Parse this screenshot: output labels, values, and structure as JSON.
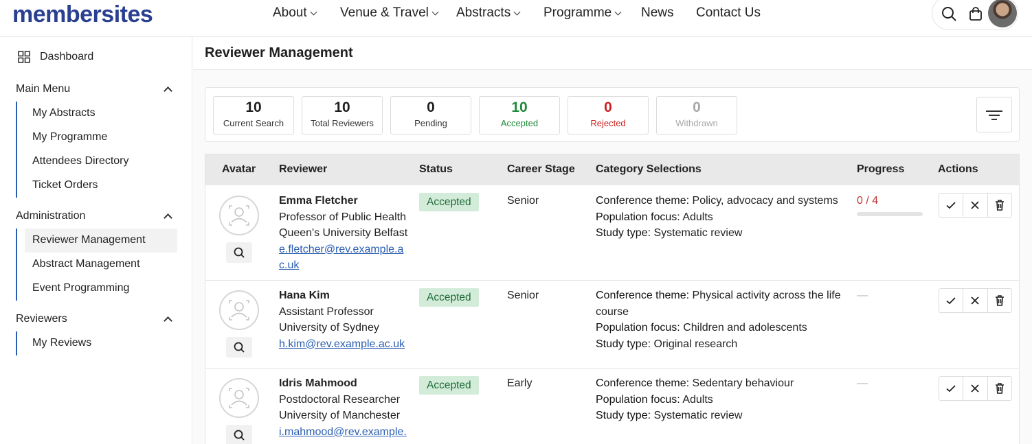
{
  "brand": {
    "logo_text": "membersites",
    "color": "#2a3f8f"
  },
  "nav": {
    "items": [
      {
        "label": "About",
        "has_dropdown": true
      },
      {
        "label": "Venue & Travel",
        "has_dropdown": true
      },
      {
        "label": "Abstracts",
        "has_dropdown": true
      },
      {
        "label": "Programme",
        "has_dropdown": true
      },
      {
        "label": "News",
        "has_dropdown": false
      },
      {
        "label": "Contact Us",
        "has_dropdown": false
      }
    ],
    "icons": [
      "search-icon",
      "cart-icon",
      "user-avatar"
    ]
  },
  "sidebar": {
    "dashboard_label": "Dashboard",
    "sections": [
      {
        "title": "Main Menu",
        "items": [
          "My Abstracts",
          "My Programme",
          "Attendees Directory",
          "Ticket Orders"
        ]
      },
      {
        "title": "Administration",
        "items": [
          "Reviewer Management",
          "Abstract Management",
          "Event Programming"
        ],
        "active": "Reviewer Management"
      },
      {
        "title": "Reviewers",
        "items": [
          "My Reviews"
        ]
      }
    ]
  },
  "page": {
    "title": "Reviewer Management"
  },
  "stats": [
    {
      "value": "10",
      "label": "Current Search",
      "tone": "default"
    },
    {
      "value": "10",
      "label": "Total Reviewers",
      "tone": "default"
    },
    {
      "value": "0",
      "label": "Pending",
      "tone": "default"
    },
    {
      "value": "10",
      "label": "Accepted",
      "tone": "green"
    },
    {
      "value": "0",
      "label": "Rejected",
      "tone": "red"
    },
    {
      "value": "0",
      "label": "Withdrawn",
      "tone": "grey"
    }
  ],
  "table": {
    "columns": [
      "Avatar",
      "Reviewer",
      "Status",
      "Career Stage",
      "Category Selections",
      "Progress",
      "Actions"
    ],
    "rows": [
      {
        "name": "Emma Fletcher",
        "title": "Professor of Public Health",
        "institution": "Queen's University Belfast",
        "email_line1": "e.fletcher@rev.example.a",
        "email_line2": "c.uk",
        "status": "Accepted",
        "career_stage": "Senior",
        "theme_key": "Conference theme:",
        "theme_val": "Policy, advocacy and systems",
        "theme_val2": "",
        "pop_key": "Population focus:",
        "pop_val": "Adults",
        "study_key": "Study type:",
        "study_val": "Systematic review",
        "progress": "0 / 4"
      },
      {
        "name": "Hana Kim",
        "title": "Assistant Professor",
        "institution": "University of Sydney",
        "email_line1": "h.kim@rev.example.ac.uk",
        "email_line2": "",
        "status": "Accepted",
        "career_stage": "Senior",
        "theme_key": "Conference theme:",
        "theme_val": "Physical activity across the life",
        "theme_val2": "course",
        "pop_key": "Population focus:",
        "pop_val": "Children and adolescents",
        "study_key": "Study type:",
        "study_val": "Original research",
        "progress": "—"
      },
      {
        "name": "Idris Mahmood",
        "title": "Postdoctoral Researcher",
        "institution": "University of Manchester",
        "email_line1": "i.mahmood@rev.example.",
        "email_line2": "",
        "status": "Accepted",
        "career_stage": "Early",
        "theme_key": "Conference theme:",
        "theme_val": "Sedentary behaviour",
        "theme_val2": "",
        "pop_key": "Population focus:",
        "pop_val": "Adults",
        "study_key": "Study type:",
        "study_val": "Systematic review",
        "progress": "—"
      }
    ]
  },
  "colors": {
    "accent": "#2a5db0",
    "accepted_bg": "#d3ecda",
    "accepted_text": "#1f6b36",
    "progress_red": "#c73333"
  }
}
